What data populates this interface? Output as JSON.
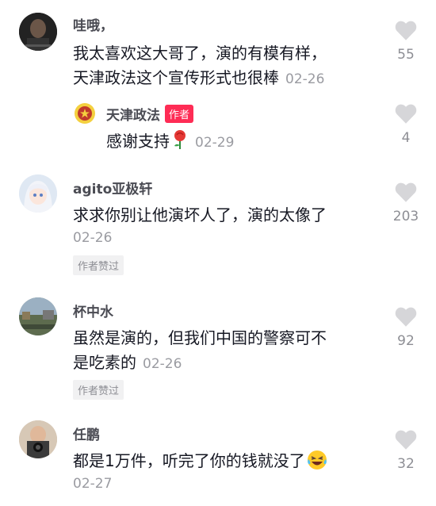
{
  "comments": [
    {
      "username": "哇哦，",
      "text": "我太喜欢这大哥了，演的有模有样，天津政法这个宣传形式也很棒",
      "line1": "我太喜欢这大哥了，演的有模有样，",
      "line2": "天津政法这个宣传形式也很棒",
      "date": "02-26",
      "likes": "55",
      "reply": {
        "username": "天津政法",
        "badge": "作者",
        "text": "感谢支持",
        "date": "02-29",
        "likes": "4"
      }
    },
    {
      "username": "agito亚极轩",
      "text": "求求你别让他演坏人了，演的太像了",
      "date": "02-26",
      "likes": "203",
      "tag": "作者赞过"
    },
    {
      "username": "杯中水",
      "line1": "虽然是演的，但我们中国的警察可不",
      "line2": "是吃素的",
      "date": "02-26",
      "likes": "92",
      "tag": "作者赞过"
    },
    {
      "username": "任鹏",
      "text": "都是1万件，听完了你的钱就没了",
      "date": "02-27",
      "likes": "32"
    }
  ],
  "icons": {
    "like": "heart-icon",
    "rose": "rose-emoji-icon",
    "laugh": "laughing-crying-emoji-icon",
    "author_logo": "police-emblem-icon"
  },
  "colors": {
    "accent": "#fe2c55",
    "heart": "#d6d6d9",
    "secondary_text": "#8d8e94"
  }
}
